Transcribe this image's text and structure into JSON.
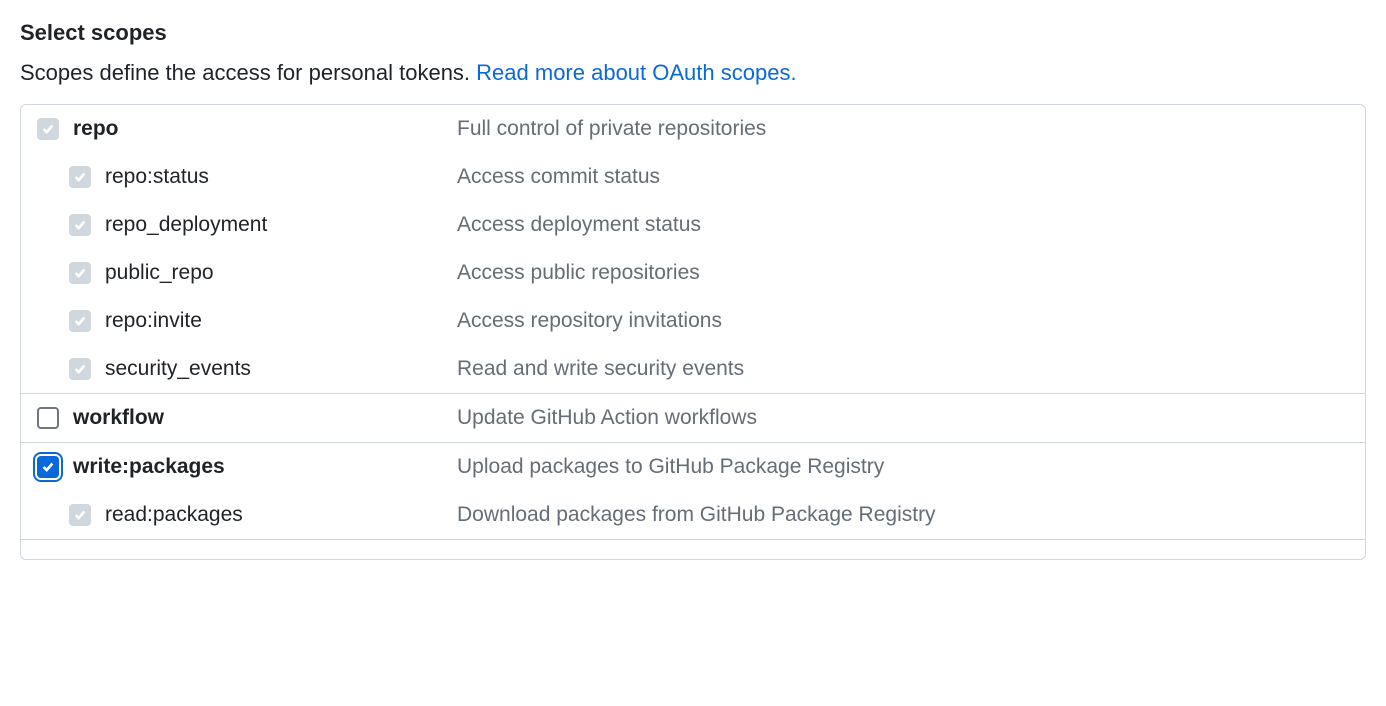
{
  "heading": "Select scopes",
  "subheading_text": "Scopes define the access for personal tokens. ",
  "subheading_link": "Read more about OAuth scopes.",
  "scope_groups": [
    {
      "parent": {
        "name": "repo",
        "desc": "Full control of private repositories",
        "state": "checked-disabled",
        "bold": true
      },
      "children": [
        {
          "name": "repo:status",
          "desc": "Access commit status",
          "state": "checked-disabled"
        },
        {
          "name": "repo_deployment",
          "desc": "Access deployment status",
          "state": "checked-disabled"
        },
        {
          "name": "public_repo",
          "desc": "Access public repositories",
          "state": "checked-disabled"
        },
        {
          "name": "repo:invite",
          "desc": "Access repository invitations",
          "state": "checked-disabled"
        },
        {
          "name": "security_events",
          "desc": "Read and write security events",
          "state": "checked-disabled"
        }
      ]
    },
    {
      "parent": {
        "name": "workflow",
        "desc": "Update GitHub Action workflows",
        "state": "unchecked",
        "bold": true
      },
      "children": []
    },
    {
      "parent": {
        "name": "write:packages",
        "desc": "Upload packages to GitHub Package Registry",
        "state": "checked-active",
        "bold": true
      },
      "children": [
        {
          "name": "read:packages",
          "desc": "Download packages from GitHub Package Registry",
          "state": "checked-disabled"
        }
      ]
    }
  ]
}
